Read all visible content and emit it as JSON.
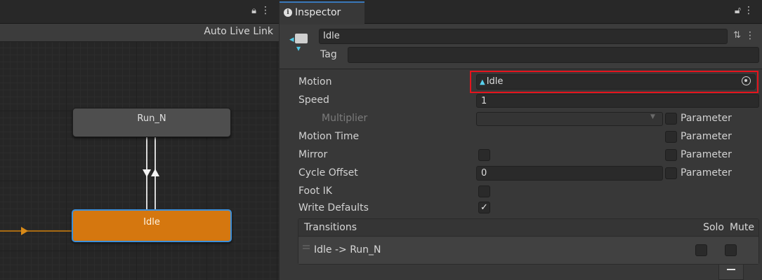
{
  "animator": {
    "lock_icon": "lock-icon",
    "menu_icon": "kebab-menu-icon",
    "auto_live_link": "Auto Live Link",
    "states": [
      {
        "name": "Run_N",
        "color": "#4e4e4e"
      },
      {
        "name": "Idle",
        "color": "#d5770f",
        "default": true,
        "selected": true
      }
    ]
  },
  "inspector": {
    "tab_label": "Inspector",
    "tab_icon": "info-icon",
    "state_name": "Idle",
    "tag_label": "Tag",
    "tag_value": "",
    "rows": {
      "motion": {
        "label": "Motion",
        "value": "Idle"
      },
      "speed": {
        "label": "Speed",
        "value": "1"
      },
      "multiplier": {
        "label": "Multiplier",
        "value": ""
      },
      "motion_time": {
        "label": "Motion Time"
      },
      "mirror": {
        "label": "Mirror",
        "checked": false
      },
      "cycle_offset": {
        "label": "Cycle Offset",
        "value": "0"
      },
      "foot_ik": {
        "label": "Foot IK",
        "checked": false
      },
      "write_defaults": {
        "label": "Write Defaults",
        "checked": true,
        "check_mark": "✓"
      }
    },
    "parameter_label": "Parameter",
    "transitions": {
      "title": "Transitions",
      "solo": "Solo",
      "mute": "Mute",
      "items": [
        {
          "name": "Idle -> Run_N",
          "solo": false,
          "mute": false
        }
      ]
    },
    "colors": {
      "highlight": "#e5141d",
      "selection_border": "#3d8fd9",
      "accent_tab": "#3a79bb"
    }
  }
}
